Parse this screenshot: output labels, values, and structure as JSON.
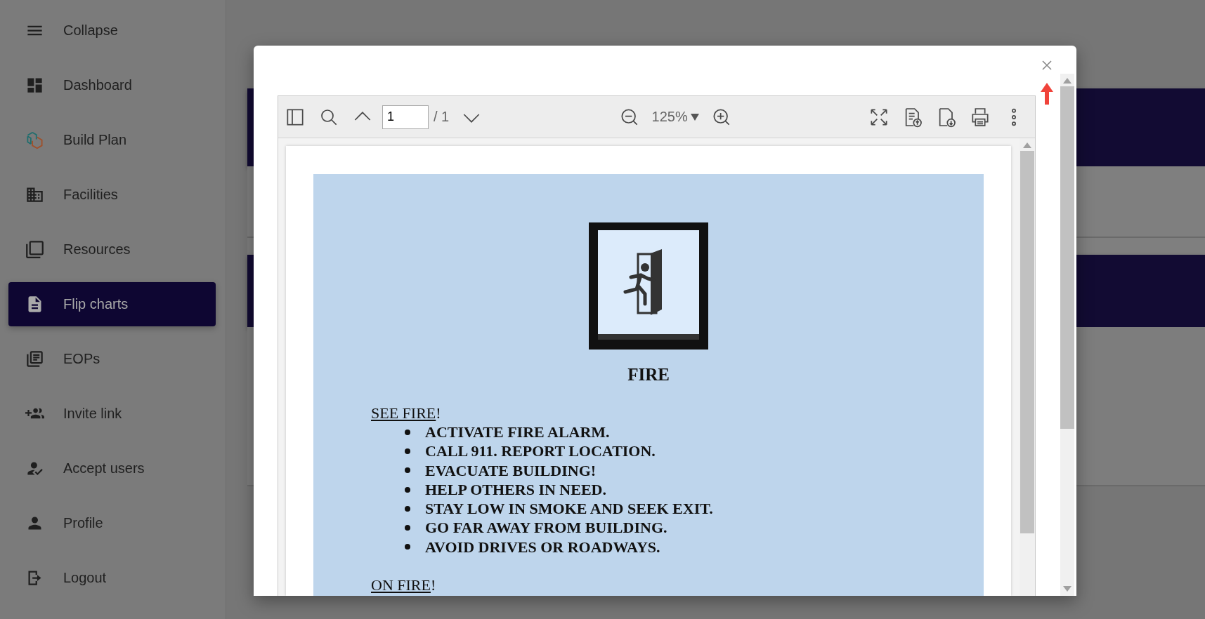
{
  "sidebar": {
    "items": [
      {
        "label": "Collapse",
        "selected": false
      },
      {
        "label": "Dashboard",
        "selected": false
      },
      {
        "label": "Build Plan",
        "selected": false
      },
      {
        "label": "Facilities",
        "selected": false
      },
      {
        "label": "Resources",
        "selected": false
      },
      {
        "label": "Flip charts",
        "selected": true
      },
      {
        "label": "EOPs",
        "selected": false
      },
      {
        "label": "Invite link",
        "selected": false
      },
      {
        "label": "Accept users",
        "selected": false
      },
      {
        "label": "Profile",
        "selected": false
      },
      {
        "label": "Logout",
        "selected": false
      }
    ]
  },
  "modal": {
    "toolbar": {
      "page": "1",
      "page_total": "/ 1",
      "zoom": "125%"
    },
    "document": {
      "title": "FIRE",
      "sections": [
        {
          "heading": {
            "underlined": "SEE FIRE",
            "suffix": "!"
          },
          "items": [
            "ACTIVATE FIRE ALARM.",
            "CALL 911. REPORT LOCATION.",
            "EVACUATE BUILDING!",
            "HELP OTHERS IN NEED.",
            "STAY LOW IN SMOKE AND SEEK EXIT.",
            "GO FAR AWAY FROM BUILDING.",
            "AVOID DRIVES OR ROADWAYS."
          ]
        },
        {
          "heading": {
            "underlined": "ON FIRE",
            "suffix": "!"
          }
        }
      ]
    }
  }
}
